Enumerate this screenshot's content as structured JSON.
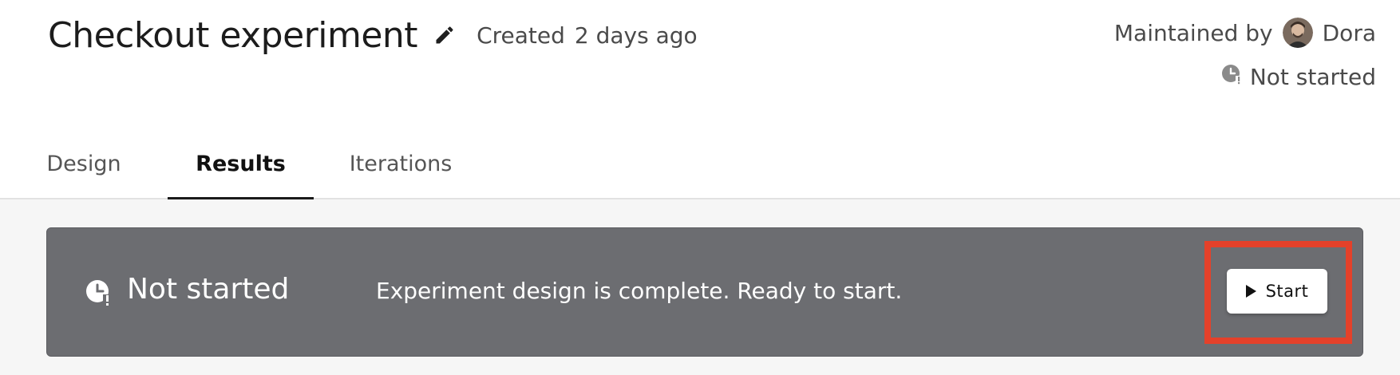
{
  "header": {
    "title": "Checkout experiment",
    "created_label": "Created",
    "created_value": "2 days ago",
    "maintained_label": "Maintained by",
    "maintainer_name": "Dora",
    "status": "Not started"
  },
  "tabs": [
    {
      "label": "Design"
    },
    {
      "label": "Results",
      "active": true
    },
    {
      "label": "Iterations"
    }
  ],
  "banner": {
    "status": "Not started",
    "message": "Experiment design is complete. Ready to start.",
    "start_label": "Start"
  },
  "colors": {
    "banner_bg": "#6c6d71",
    "highlight": "#e4412a",
    "page_bg": "#f6f6f6"
  },
  "icons": [
    "edit-icon",
    "avatar",
    "clock-icon",
    "play-icon"
  ]
}
